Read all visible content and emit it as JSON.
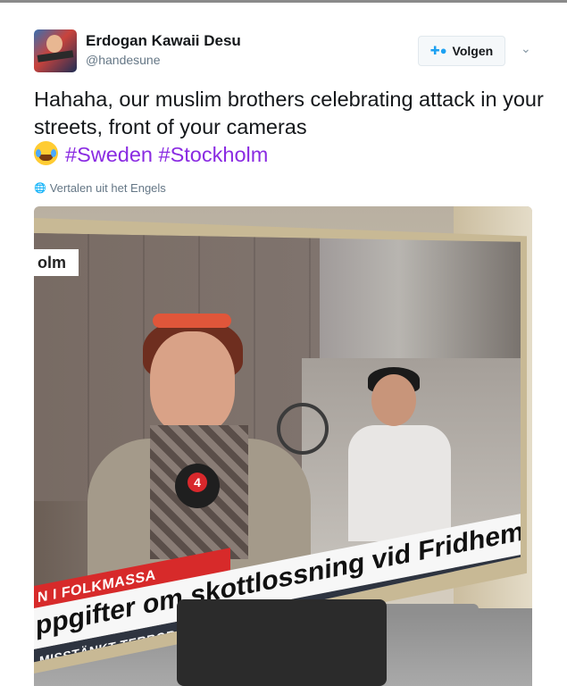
{
  "tweet": {
    "author": {
      "display_name": "Erdogan Kawaii Desu",
      "handle": "@handesune"
    },
    "follow_button": {
      "label": "Volgen",
      "icon": "add-user-icon"
    },
    "menu_icon": "chevron-down-icon",
    "text": "Hahaha, our muslim brothers celebrating attack in your streets, front of your cameras",
    "emoji": "face-with-tears-of-joy",
    "hashtags": [
      "#Sweden",
      "#Stockholm"
    ],
    "translate_link": "Vertalen uit het Engels",
    "translate_icon": "globe-icon",
    "colors": {
      "hashtag": "#8a2be2",
      "follow_icon": "#1da1f2",
      "secondary_text": "#657786"
    }
  },
  "media": {
    "tv": {
      "station_label": "olm",
      "mic_logo": "4",
      "ticker_top": "N I FOLKMASSA",
      "ticker_headline": "ppgifter om skottlossning vid Fridhemsplan",
      "ticker_bottom": "MISSTÄNKT TERRORATTENTAT  •  ALL TUNNELBANETRAFIK HAR STOPPATS",
      "colors": {
        "ticker_red": "#d72a2a",
        "ticker_dark": "#2e3440"
      }
    }
  }
}
